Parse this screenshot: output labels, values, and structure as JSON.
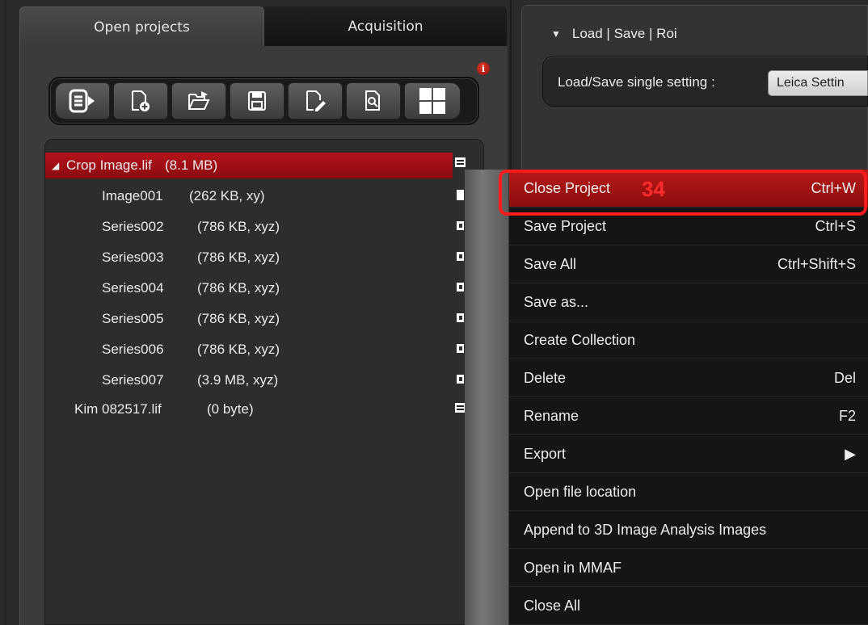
{
  "tabs": [
    {
      "label": "Open projects"
    },
    {
      "label": "Acquisition"
    }
  ],
  "info_badge": "i",
  "toolbar": {
    "buttons": [
      {
        "icon": "export-list-icon"
      },
      {
        "icon": "new-project-icon"
      },
      {
        "icon": "open-folder-icon"
      },
      {
        "icon": "save-icon"
      },
      {
        "icon": "edit-document-icon"
      },
      {
        "icon": "search-document-icon"
      },
      {
        "icon": "grid-layout-icon"
      }
    ]
  },
  "tree": {
    "projects": [
      {
        "name": "Crop Image.lif",
        "size": "(8.1 MB)",
        "expanded": true,
        "selected": true,
        "children": [
          {
            "name": "Image001",
            "size": "(262 KB, xy)"
          },
          {
            "name": "Series002",
            "size": "(786 KB, xyz)"
          },
          {
            "name": "Series003",
            "size": "(786 KB, xyz)"
          },
          {
            "name": "Series004",
            "size": "(786 KB, xyz)"
          },
          {
            "name": "Series005",
            "size": "(786 KB, xyz)"
          },
          {
            "name": "Series006",
            "size": "(786 KB, xyz)"
          },
          {
            "name": "Series007",
            "size": "(3.9 MB, xyz)"
          }
        ]
      },
      {
        "name": "Kim 082517.lif",
        "size": "(0 byte)",
        "expanded": false,
        "selected": false,
        "children": []
      }
    ]
  },
  "right_panel": {
    "section_title": "Load | Save | Roi",
    "load_save_label": "Load/Save single setting :",
    "load_save_value": "Leica Settin"
  },
  "context_menu": {
    "items": [
      {
        "label": "Close Project",
        "shortcut": "Ctrl+W",
        "active": true
      },
      {
        "label": "Save Project",
        "shortcut": "Ctrl+S"
      },
      {
        "label": "Save All",
        "shortcut": "Ctrl+Shift+S"
      },
      {
        "label": "Save as...",
        "shortcut": ""
      },
      {
        "label": "Create Collection",
        "shortcut": ""
      },
      {
        "label": "Delete",
        "shortcut": "Del"
      },
      {
        "label": "Rename",
        "shortcut": "F2"
      },
      {
        "label": "Export",
        "shortcut": "▶"
      },
      {
        "label": "Open file location",
        "shortcut": ""
      },
      {
        "label": "Append to 3D Image Analysis Images",
        "shortcut": ""
      },
      {
        "label": "Open in MMAF",
        "shortcut": ""
      },
      {
        "label": "Close All",
        "shortcut": ""
      }
    ]
  },
  "annotation": {
    "number": "34",
    "color": "#ff1b1b"
  },
  "colors": {
    "selection": "#b5131a",
    "background": "#2b2b2b"
  }
}
